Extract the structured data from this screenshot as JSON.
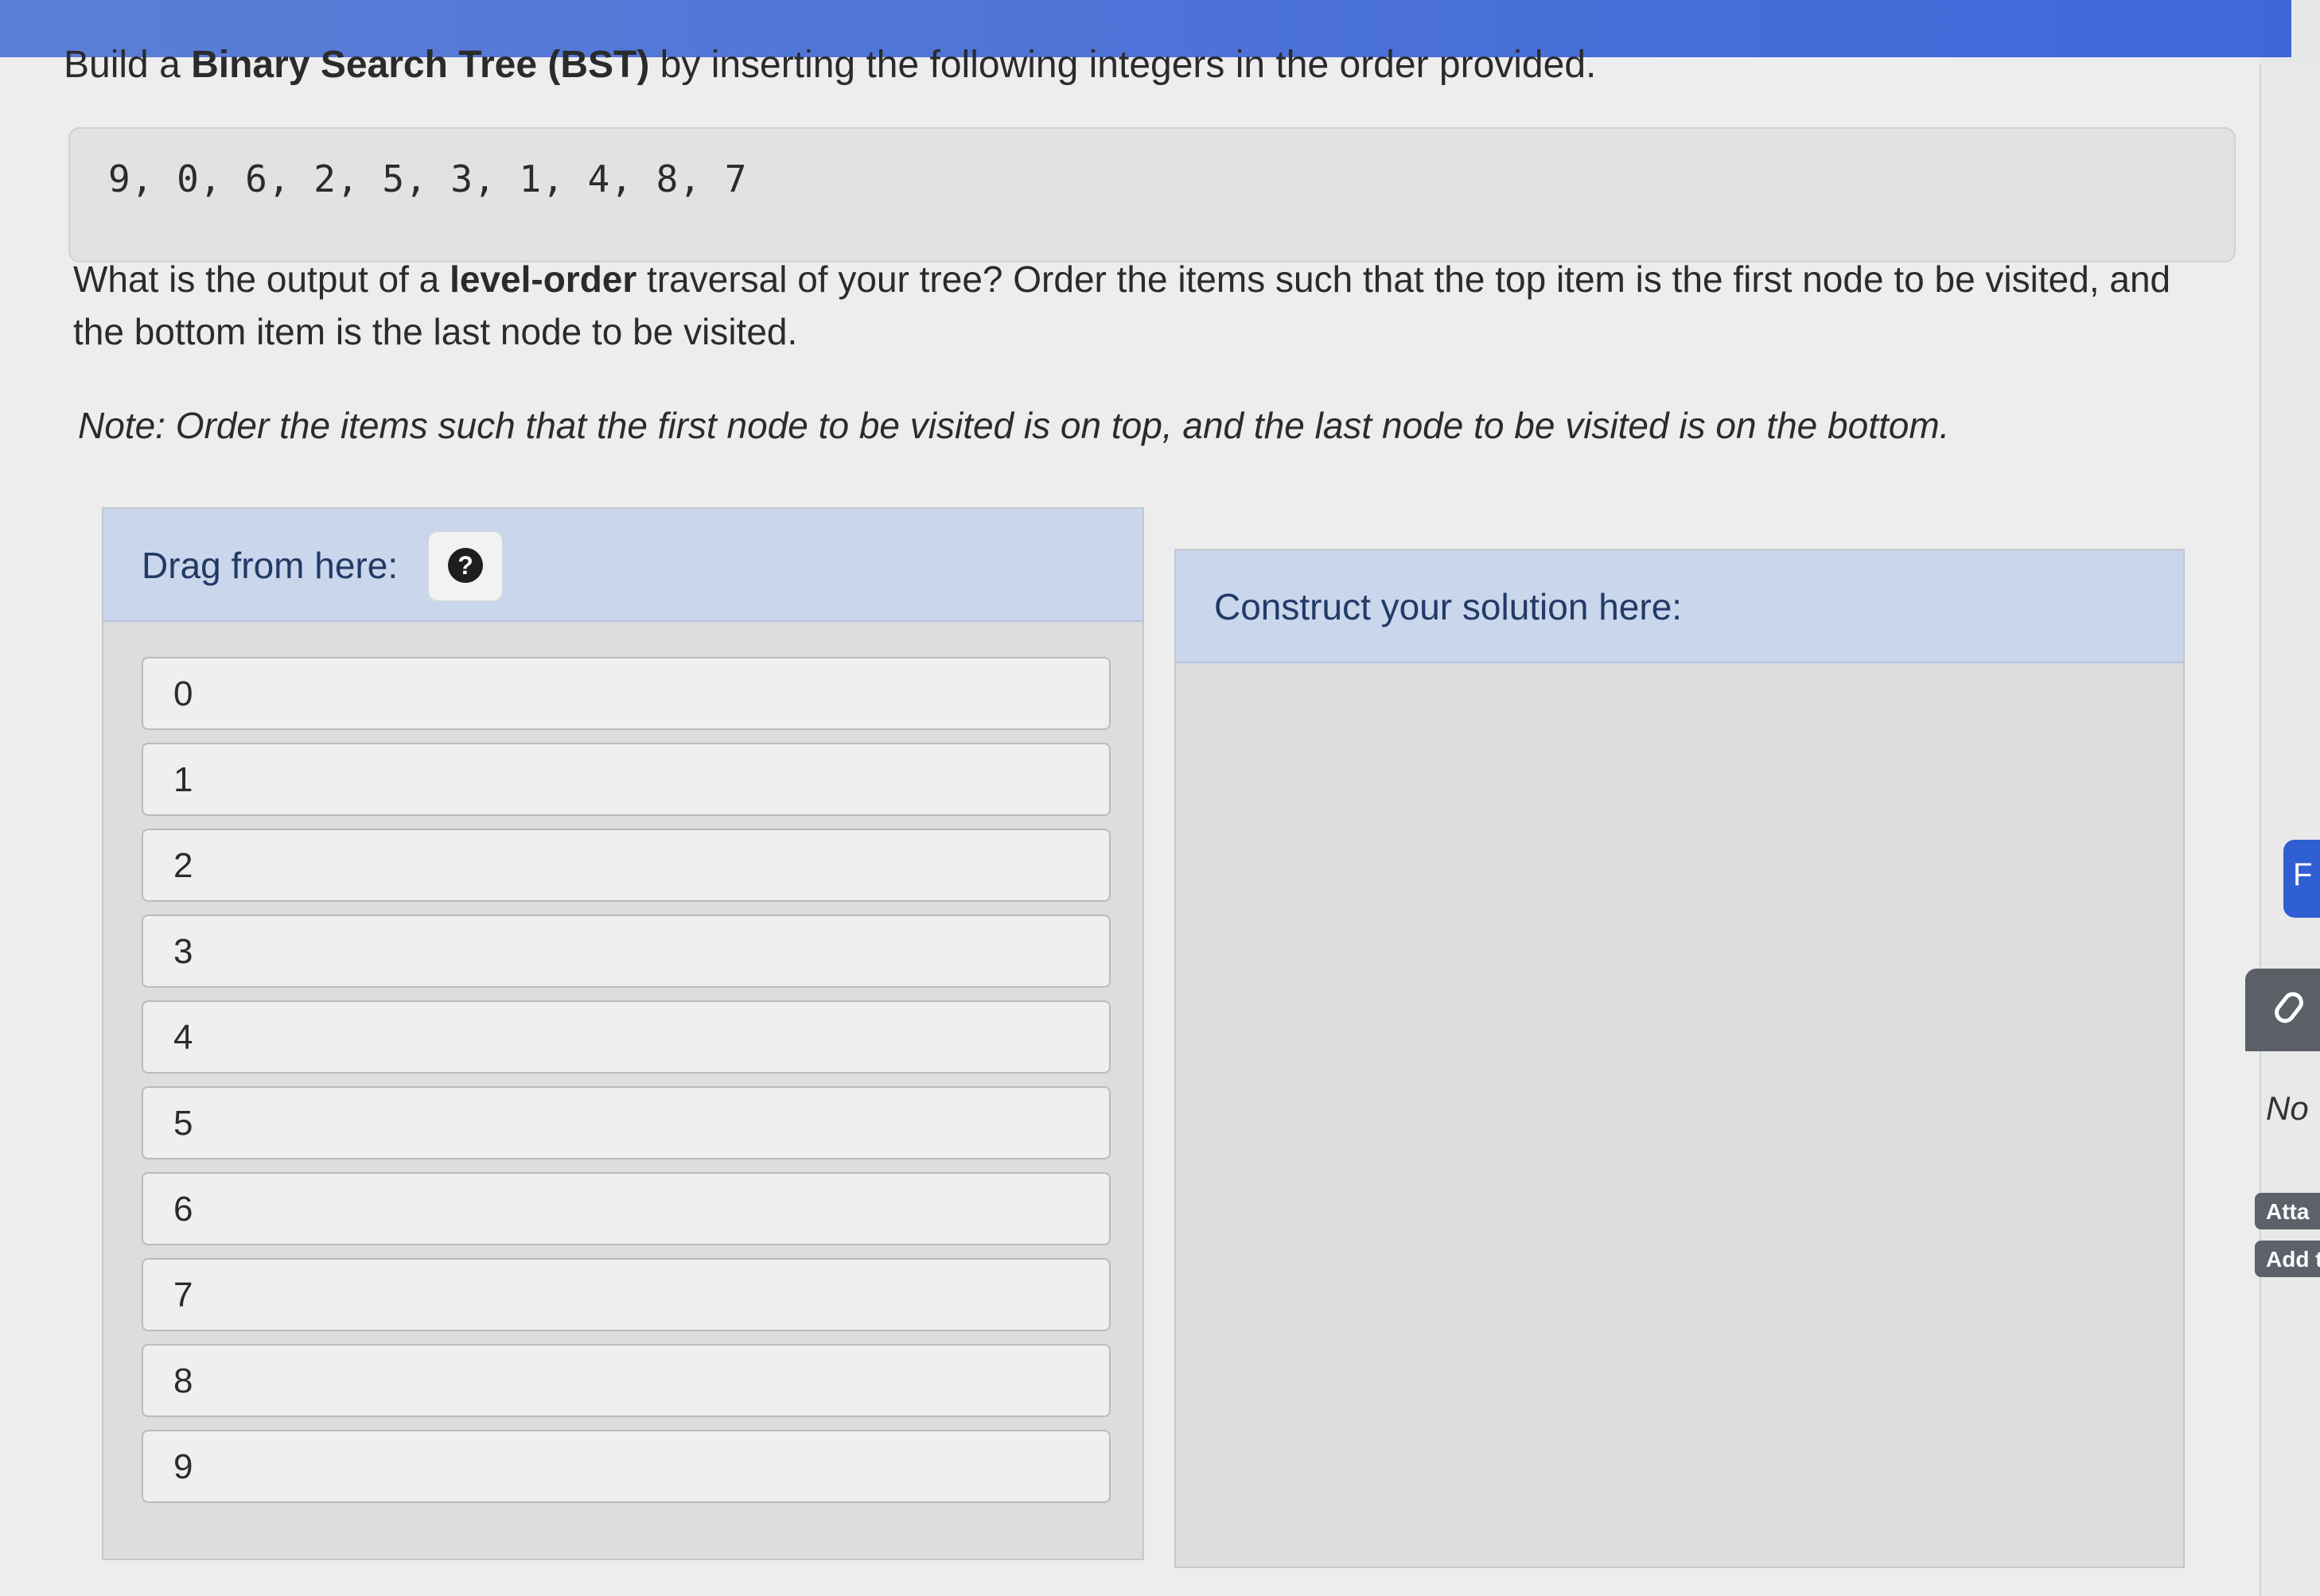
{
  "prompt": {
    "part1": "Build a ",
    "bold": "Binary Search Tree (BST)",
    "part2": " by inserting the following integers in the order provided."
  },
  "sequence": "9, 0, 6, 2, 5, 3, 1, 4, 8, 7",
  "question": {
    "part1": "What is the output of a ",
    "bold": "level-order",
    "part2": " traversal of your tree? Order the items such that the top item is the first node to be visited, and the bottom item is the last node to be visited."
  },
  "note": "Note: Order the items such that the first node to be visited is on top, and the last node to be visited is on the bottom.",
  "source_panel": {
    "label": "Drag from here:",
    "help_icon": "?",
    "items": [
      "0",
      "1",
      "2",
      "3",
      "4",
      "5",
      "6",
      "7",
      "8",
      "9"
    ]
  },
  "solution_panel": {
    "label": "Construct your solution here:"
  },
  "side": {
    "tab_letter": "F",
    "no_text": "No",
    "attach_label": "Atta",
    "add_label": "Add t"
  },
  "colors": {
    "header_bg": "#c9d6ec",
    "accent_blue": "#2f5fd2"
  }
}
